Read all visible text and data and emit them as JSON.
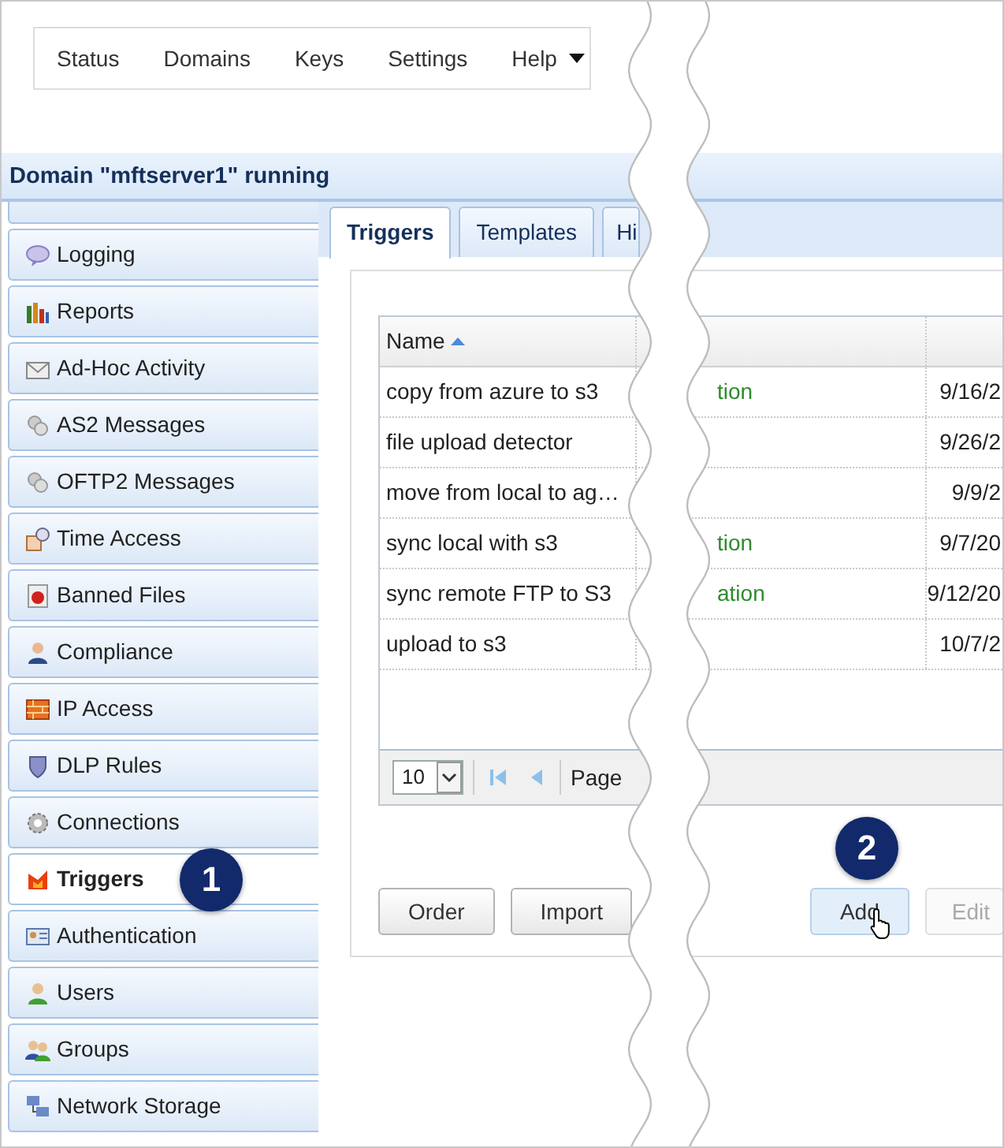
{
  "nav": [
    {
      "label": "Status"
    },
    {
      "label": "Domains"
    },
    {
      "label": "Keys"
    },
    {
      "label": "Settings"
    },
    {
      "label": "Help",
      "dropdown": true
    }
  ],
  "header": "Domain \"mftserver1\" running",
  "sidebar": {
    "items": [
      {
        "label": "Logging",
        "selected": false
      },
      {
        "label": "Reports",
        "selected": false
      },
      {
        "label": "Ad-Hoc Activity",
        "selected": false
      },
      {
        "label": "AS2 Messages",
        "selected": false
      },
      {
        "label": "OFTP2 Messages",
        "selected": false
      },
      {
        "label": "Time Access",
        "selected": false
      },
      {
        "label": "Banned Files",
        "selected": false
      },
      {
        "label": "Compliance",
        "selected": false
      },
      {
        "label": "IP Access",
        "selected": false
      },
      {
        "label": "DLP Rules",
        "selected": false
      },
      {
        "label": "Connections",
        "selected": false
      },
      {
        "label": "Triggers",
        "selected": true
      },
      {
        "label": "Authentication",
        "selected": false
      },
      {
        "label": "Users",
        "selected": false
      },
      {
        "label": "Groups",
        "selected": false
      },
      {
        "label": "Network Storage",
        "selected": false
      }
    ]
  },
  "tabs": [
    {
      "label": "Triggers",
      "selected": true
    },
    {
      "label": "Templates",
      "selected": false
    },
    {
      "label": "Hi",
      "selected": false
    }
  ],
  "table": {
    "columns": [
      {
        "label": "Name",
        "sorted": true
      }
    ],
    "rows": [
      {
        "name": "copy from azure to s3",
        "column_2": "tion",
        "column_3": "9/16/2"
      },
      {
        "name": "file upload detector",
        "column_3": "9/26/2"
      },
      {
        "name": "move from local to ag…",
        "column_3": "9/9/2"
      },
      {
        "name": "sync local with s3",
        "column_2": "tion",
        "column_3": "9/7/20"
      },
      {
        "name": "sync remote FTP to S3",
        "column_2": "ation",
        "column_3": "9/12/20"
      },
      {
        "name": "upload to s3",
        "column_3": "10/7/2"
      }
    ]
  },
  "pager": {
    "page_size": "10",
    "label": "Page"
  },
  "buttons": [
    {
      "label": "Order",
      "disabled": false,
      "hover": false
    },
    {
      "label": "Import",
      "disabled": false,
      "hover": false
    },
    {
      "label": "Add",
      "disabled": false,
      "hover": true
    },
    {
      "label": "Edit",
      "disabled": true,
      "hover": false
    }
  ],
  "callouts": [
    {
      "number": "1"
    },
    {
      "number": "2"
    }
  ]
}
